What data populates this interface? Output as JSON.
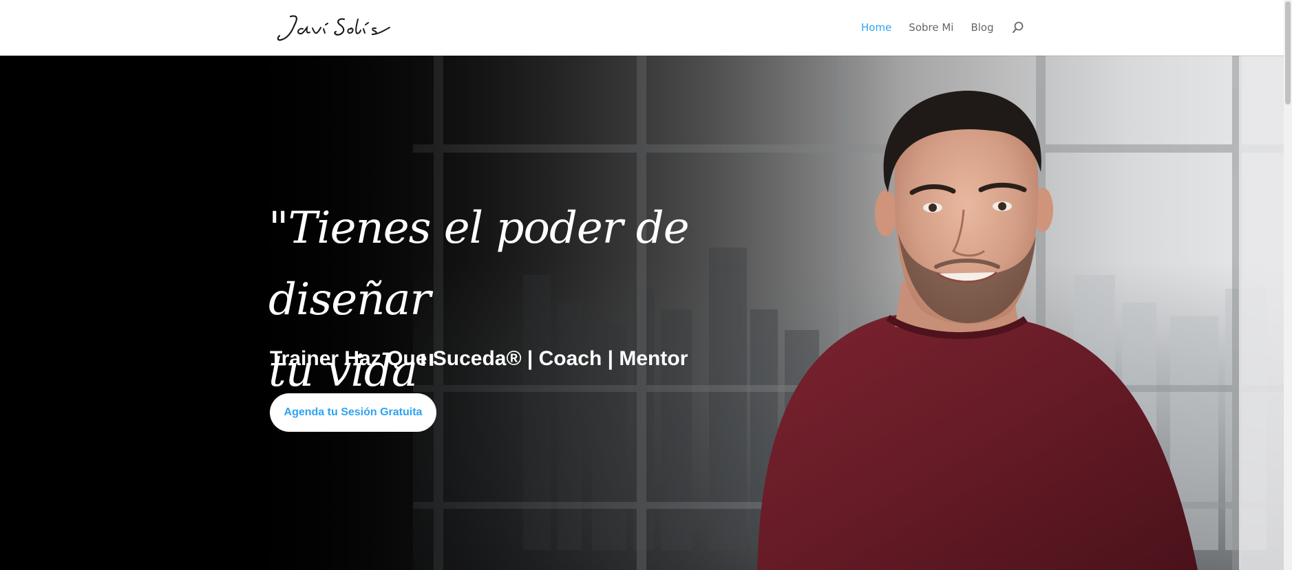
{
  "header": {
    "logo_text": "Javi Solís",
    "nav": [
      {
        "label": "Home",
        "active": true
      },
      {
        "label": "Sobre Mi",
        "active": false
      },
      {
        "label": "Blog",
        "active": false
      }
    ],
    "search_icon": "search-icon"
  },
  "hero": {
    "quote_line1": "\"Tienes el poder de diseñar",
    "quote_line2": "tu vida\"",
    "subtitle": "Trainer Haz Que Suceda® | Coach | Mentor",
    "cta_label": "Agenda tu Sesión Gratuita"
  },
  "colors": {
    "accent": "#2ea3f2",
    "nav_text": "#666666",
    "hero_text": "#ffffff",
    "sweater": "#6b1a24"
  }
}
